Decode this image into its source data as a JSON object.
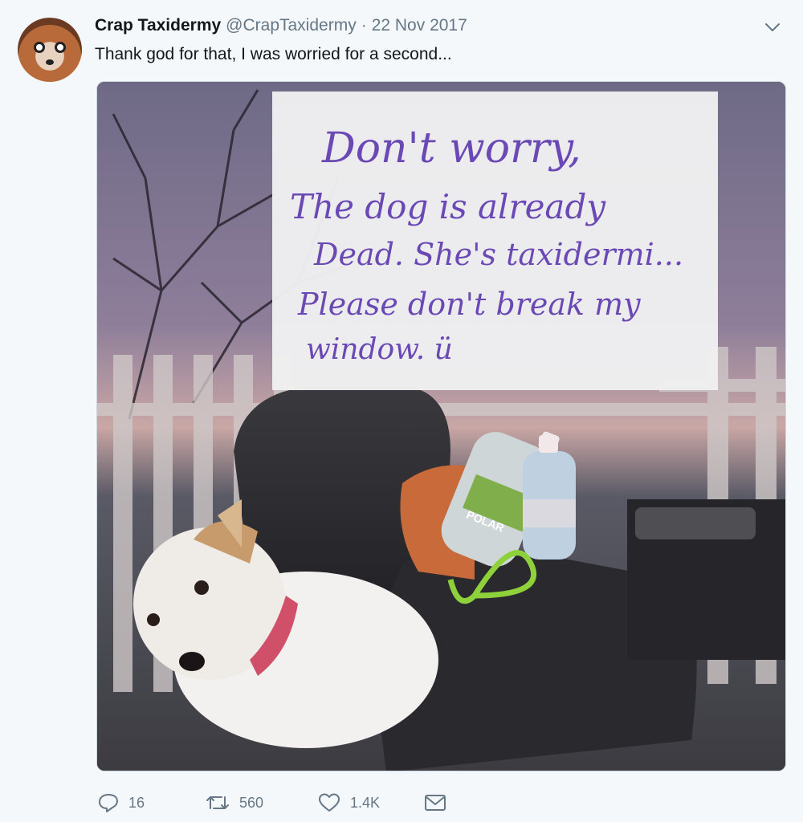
{
  "tweet": {
    "display_name": "Crap Taxidermy",
    "handle": "@CrapTaxidermy",
    "separator": "·",
    "date": "22 Nov 2017",
    "text": "Thank god for that, I was worried for a second...",
    "media": {
      "sign_lines": [
        "Don't worry,",
        "The dog is already",
        "Dead. She's taxidermi...",
        "Please don't break my",
        "window. ü"
      ],
      "bottle_label": "POLAR"
    },
    "actions": {
      "reply_count": "16",
      "retweet_count": "560",
      "like_count": "1.4K"
    }
  },
  "icons": {
    "menu": "chevron-down-icon",
    "reply": "reply-icon",
    "retweet": "retweet-icon",
    "like": "heart-icon",
    "dm": "envelope-icon"
  },
  "colors": {
    "text": "#14171a",
    "secondary": "#657786",
    "background": "#f5f8fa",
    "ink": "#6b49b5"
  }
}
